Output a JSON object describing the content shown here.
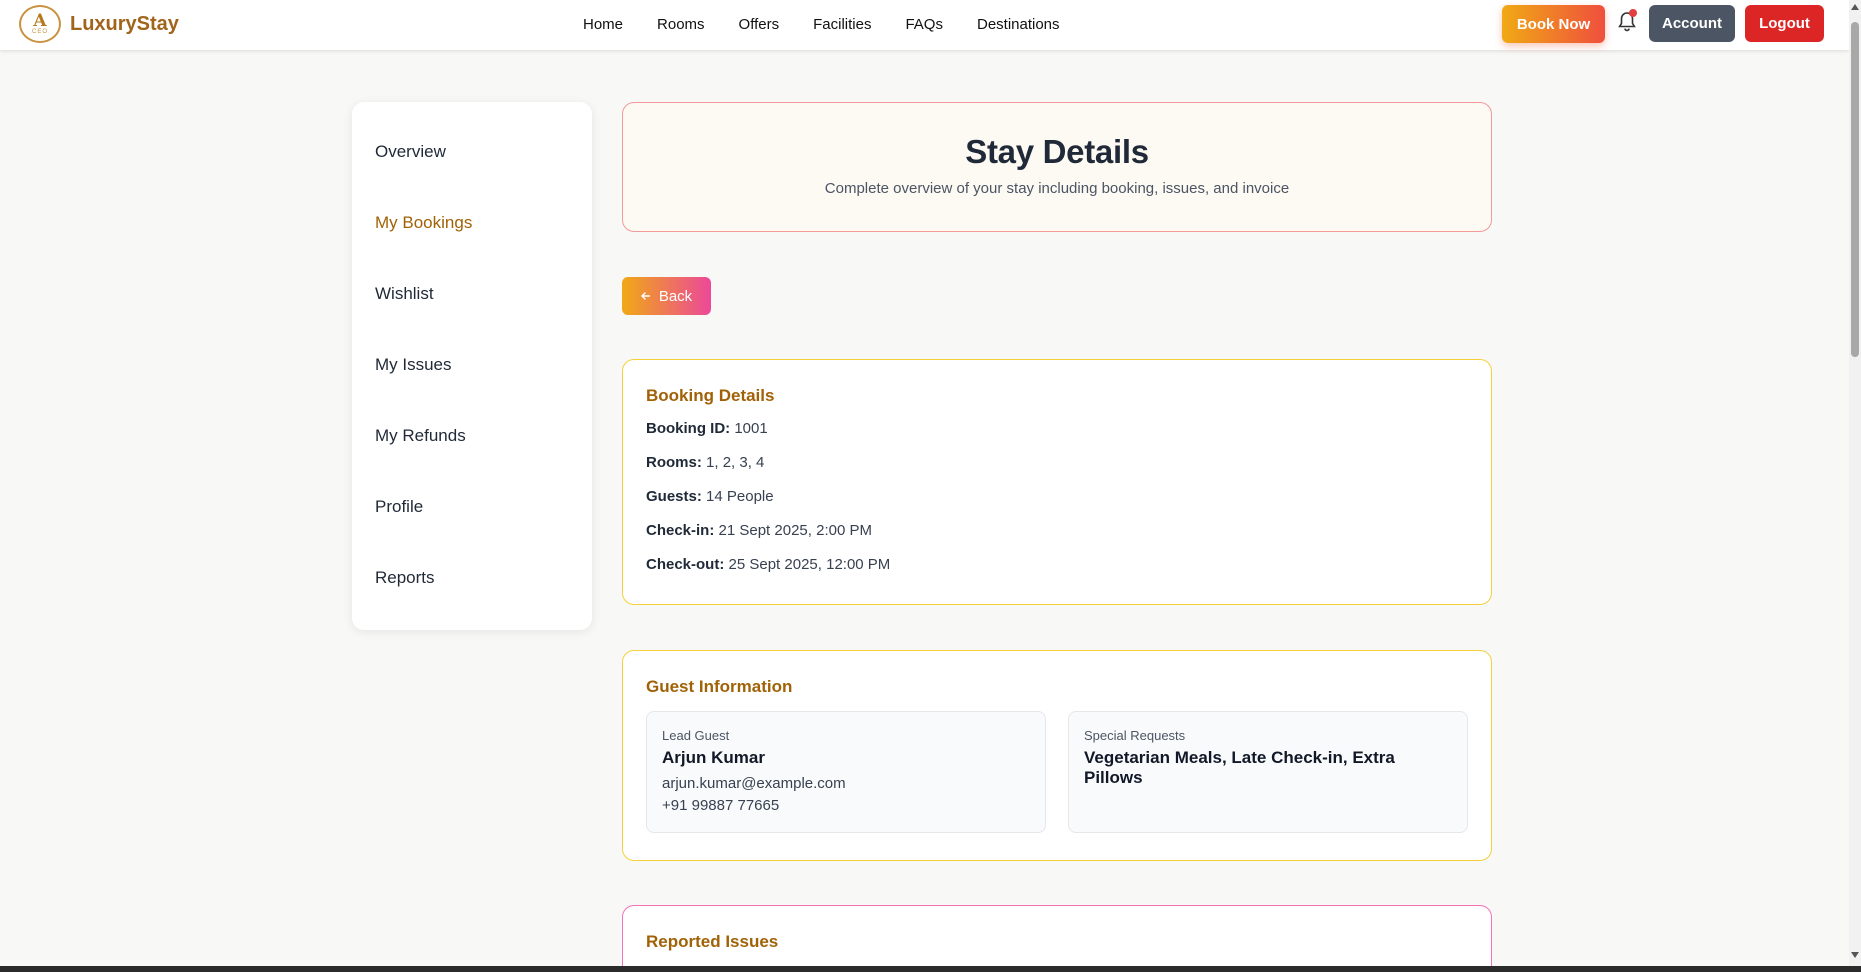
{
  "brand": {
    "name": "LuxuryStay",
    "logo_letter": "A",
    "logo_sub": "CEO"
  },
  "nav": {
    "items": [
      "Home",
      "Rooms",
      "Offers",
      "Facilities",
      "FAQs",
      "Destinations"
    ]
  },
  "header_actions": {
    "book_now": "Book Now",
    "account": "Account",
    "logout": "Logout"
  },
  "sidebar": {
    "items": [
      {
        "label": "Overview",
        "active": false
      },
      {
        "label": "My Bookings",
        "active": true
      },
      {
        "label": "Wishlist",
        "active": false
      },
      {
        "label": "My Issues",
        "active": false
      },
      {
        "label": "My Refunds",
        "active": false
      },
      {
        "label": "Profile",
        "active": false
      },
      {
        "label": "Reports",
        "active": false
      }
    ]
  },
  "hero": {
    "title": "Stay Details",
    "subtitle": "Complete overview of your stay including booking, issues, and invoice"
  },
  "back_button": {
    "icon": "arrow-left-icon",
    "label": "Back"
  },
  "booking_details": {
    "title": "Booking Details",
    "rows": [
      {
        "label": "Booking ID:",
        "value": "1001"
      },
      {
        "label": "Rooms:",
        "value": "1, 2, 3, 4"
      },
      {
        "label": "Guests:",
        "value": "14 People"
      },
      {
        "label": "Check-in:",
        "value": "21 Sept 2025, 2:00 PM"
      },
      {
        "label": "Check-out:",
        "value": "25 Sept 2025, 12:00 PM"
      }
    ]
  },
  "guest_information": {
    "title": "Guest Information",
    "lead_guest": {
      "label": "Lead Guest",
      "name": "Arjun Kumar",
      "email": "arjun.kumar@example.com",
      "phone": "+91 99887 77665"
    },
    "special_requests": {
      "label": "Special Requests",
      "value": "Vegetarian Meals, Late Check-in, Extra Pillows"
    }
  },
  "reported_issues": {
    "title": "Reported Issues"
  },
  "colors": {
    "accent": "#a16207",
    "logout": "#dc2626",
    "account": "#4b5563",
    "card_border_yellow": "#f5d03b",
    "card_border_pink": "#f472b6"
  }
}
